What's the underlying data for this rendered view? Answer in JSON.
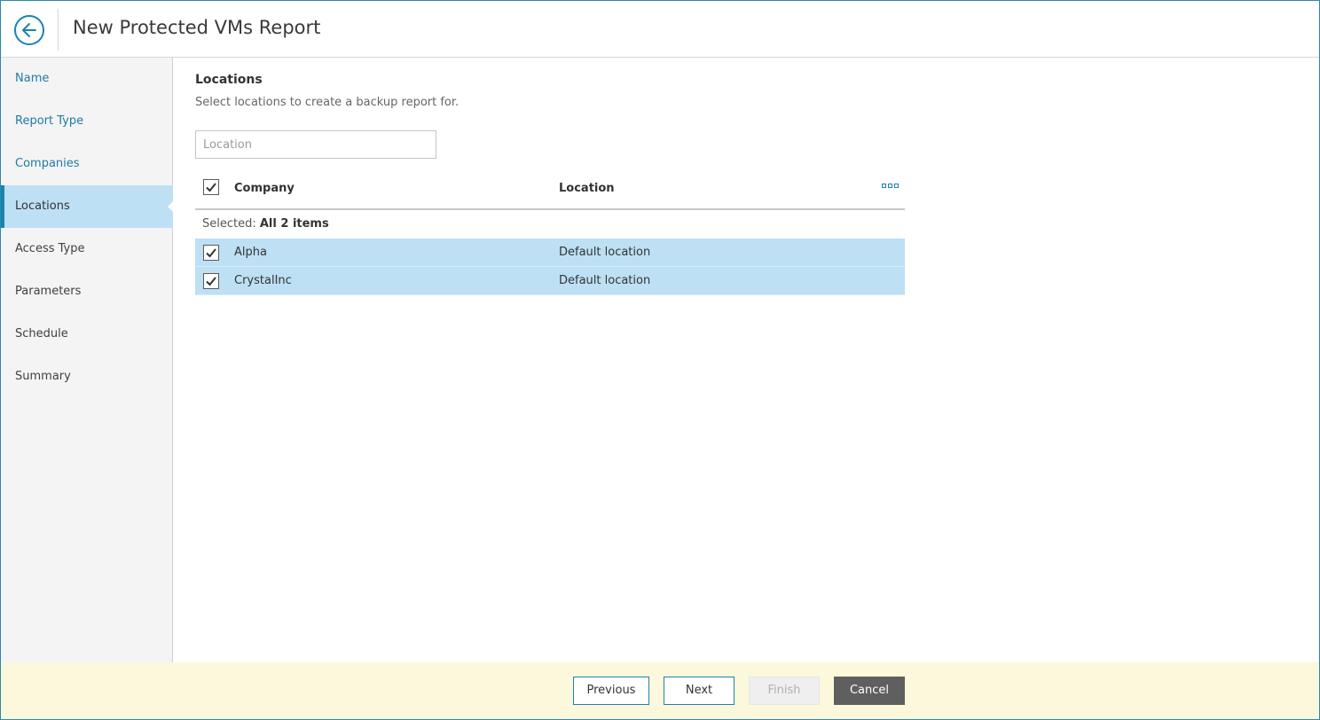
{
  "header": {
    "title": "New Protected VMs Report",
    "back_icon": "arrow-left-icon"
  },
  "sidebar": {
    "items": [
      {
        "label": "Name",
        "state": "link"
      },
      {
        "label": "Report Type",
        "state": "link"
      },
      {
        "label": "Companies",
        "state": "link"
      },
      {
        "label": "Locations",
        "state": "active"
      },
      {
        "label": "Access Type",
        "state": "disabled"
      },
      {
        "label": "Parameters",
        "state": "disabled"
      },
      {
        "label": "Schedule",
        "state": "disabled"
      },
      {
        "label": "Summary",
        "state": "disabled"
      }
    ]
  },
  "main": {
    "title": "Locations",
    "description": "Select locations to create a backup report for.",
    "search": {
      "placeholder": "Location",
      "value": ""
    },
    "grid": {
      "columns": [
        "Company",
        "Location"
      ],
      "select_all_checked": true,
      "selected_prefix": "Selected:",
      "selected_value": "All 2 items",
      "rows": [
        {
          "company": "Alpha",
          "location": "Default location",
          "checked": true
        },
        {
          "company": "CrystalInc",
          "location": "Default location",
          "checked": true
        }
      ]
    }
  },
  "footer": {
    "previous_label": "Previous",
    "next_label": "Next",
    "finish_label": "Finish",
    "cancel_label": "Cancel"
  },
  "colors": {
    "accent": "#1c82b0",
    "selection": "#bde0f5",
    "footer_bg": "#fcf8dc",
    "cancel_bg": "#5f5f5f"
  }
}
